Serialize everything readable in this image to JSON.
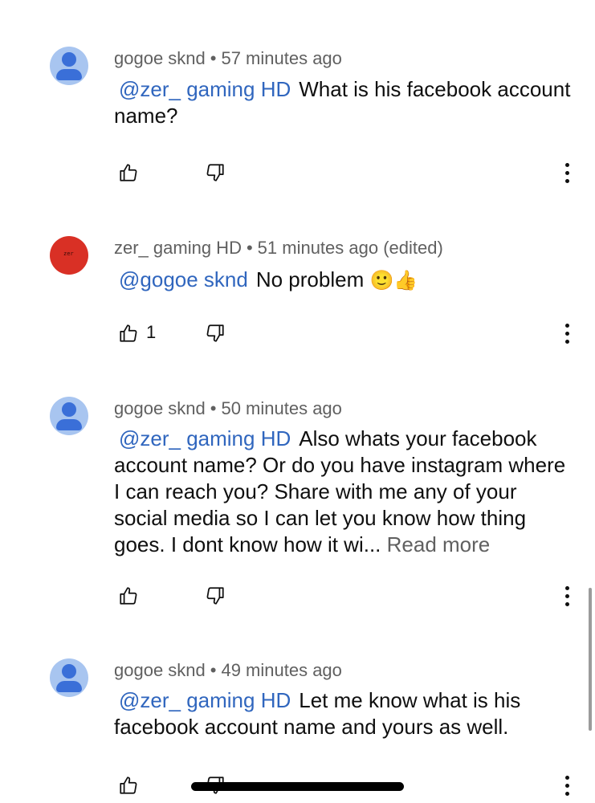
{
  "comments": [
    {
      "author": "gogoe sknd",
      "separator": "•",
      "time": "57 minutes ago",
      "mention": "@zer_ gaming HD",
      "text": "What is his facebook account name?",
      "likes": "",
      "avatar": "default-user-icon"
    },
    {
      "author": "zer_ gaming HD",
      "separator": "•",
      "time": "51 minutes ago (edited)",
      "mention": "@gogoe sknd",
      "text": "No problem",
      "emoji": "🙂👍",
      "likes": "1",
      "avatar": "red-channel-avatar",
      "avatar_mark": "zer"
    },
    {
      "author": "gogoe sknd",
      "separator": "•",
      "time": "50 minutes ago",
      "mention": "@zer_ gaming HD",
      "text": "Also whats your facebook account name? Or do you have instagram where I can reach you? Share with me any of your social media so I can let you know how thing goes. I dont know how it wi...",
      "read_more": "Read more",
      "likes": "",
      "avatar": "default-user-icon"
    },
    {
      "author": "gogoe sknd",
      "separator": "•",
      "time": "49 minutes ago",
      "mention": "@zer_ gaming HD",
      "text": "Let me know what is his facebook account name and yours as well.",
      "likes": "",
      "avatar": "default-user-icon"
    }
  ],
  "colors": {
    "mention": "#3066be",
    "meta": "#606060",
    "avatar_default_bg": "#a8c5f0",
    "avatar_default_fg": "#3a6fd8",
    "avatar_red": "#d93025"
  },
  "icons": {
    "like": "thumbs-up-icon",
    "dislike": "thumbs-down-icon",
    "more": "more-vertical-icon"
  }
}
